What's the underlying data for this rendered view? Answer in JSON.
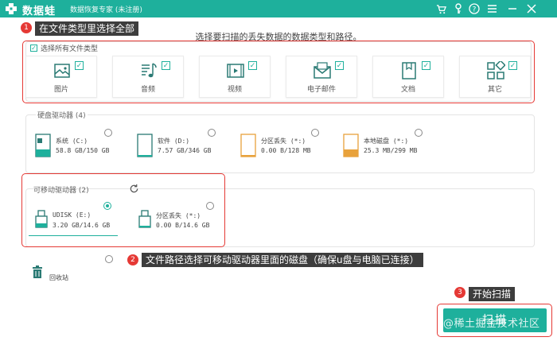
{
  "header": {
    "app_name": "数据蛙",
    "app_subtitle": "数据恢复专家 (未注册)"
  },
  "callouts": [
    {
      "num": "1",
      "text": "在文件类型里选择全部"
    },
    {
      "num": "2",
      "text": "文件路径选择可移动驱动器里面的磁盘（确保u盘与电脑已连接）"
    },
    {
      "num": "3",
      "text": "开始扫描"
    }
  ],
  "prompt_title": "选择要扫描的丢失数据的数据类型和路径。",
  "types": {
    "select_all_label": "选择所有文件类型",
    "items": [
      {
        "label": "图片",
        "icon": "image-icon"
      },
      {
        "label": "音频",
        "icon": "music-icon"
      },
      {
        "label": "视频",
        "icon": "video-icon"
      },
      {
        "label": "电子邮件",
        "icon": "email-icon"
      },
      {
        "label": "文档",
        "icon": "document-icon"
      },
      {
        "label": "其它",
        "icon": "other-icon"
      }
    ]
  },
  "hard_drives": {
    "title": "硬盘驱动器 (4)",
    "items": [
      {
        "name": "系统 (C:)",
        "size": "58.8 GB/150 GB"
      },
      {
        "name": "软件 (D:)",
        "size": "7.57 GB/346 GB"
      },
      {
        "name": "分区丢失 (*:)",
        "size": "0.00  B/128 MB"
      },
      {
        "name": "本地磁盘 (*:)",
        "size": "25.3 MB/299 MB"
      }
    ]
  },
  "removable_drives": {
    "title": "可移动驱动器 (2)",
    "items": [
      {
        "name": "UDISK (E:)",
        "size": "3.20 GB/14.6 GB"
      },
      {
        "name": "分区丢失 (*:)",
        "size": "0.00  B/14.6 GB"
      }
    ]
  },
  "recycle_bin_label": "回收站",
  "scan_button_label": "扫描",
  "watermark": "@稀土掘金技术社区",
  "colors": {
    "accent": "#1eb09c",
    "callout_bg": "#3d3d3d",
    "highlight": "#e53935"
  }
}
